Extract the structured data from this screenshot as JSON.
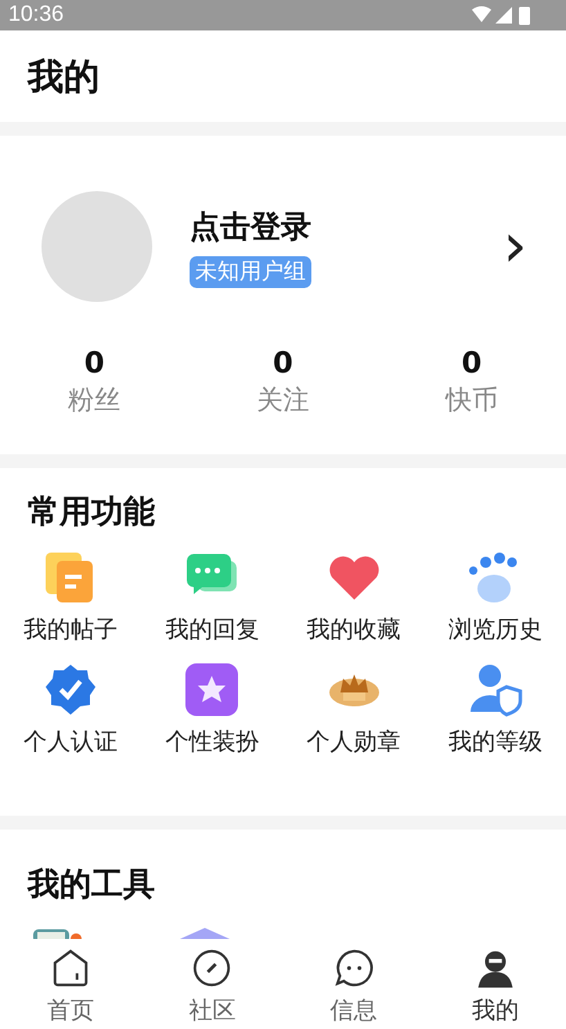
{
  "status_bar": {
    "time": "10:36"
  },
  "header": {
    "title": "我的"
  },
  "profile": {
    "name": "点击登录",
    "group": "未知用户组",
    "chevron": "›",
    "stats": [
      {
        "value": "0",
        "label": "粉丝"
      },
      {
        "value": "0",
        "label": "关注"
      },
      {
        "value": "0",
        "label": "快币"
      }
    ]
  },
  "functions": {
    "title": "常用功能",
    "items": [
      {
        "kind": "posts",
        "label": "我的帖子"
      },
      {
        "kind": "replies",
        "label": "我的回复"
      },
      {
        "kind": "favorites",
        "label": "我的收藏"
      },
      {
        "kind": "history",
        "label": "浏览历史"
      },
      {
        "kind": "verify",
        "label": "个人认证"
      },
      {
        "kind": "decor",
        "label": "个性装扮"
      },
      {
        "kind": "medal",
        "label": "个人勋章"
      },
      {
        "kind": "level",
        "label": "我的等级"
      }
    ]
  },
  "tools": {
    "title": "我的工具"
  },
  "tab_bar": [
    {
      "kind": "home",
      "label": "首页",
      "selected": false
    },
    {
      "kind": "community",
      "label": "社区",
      "selected": false
    },
    {
      "kind": "messages",
      "label": "信息",
      "selected": false
    },
    {
      "kind": "me",
      "label": "我的",
      "selected": true
    }
  ]
}
